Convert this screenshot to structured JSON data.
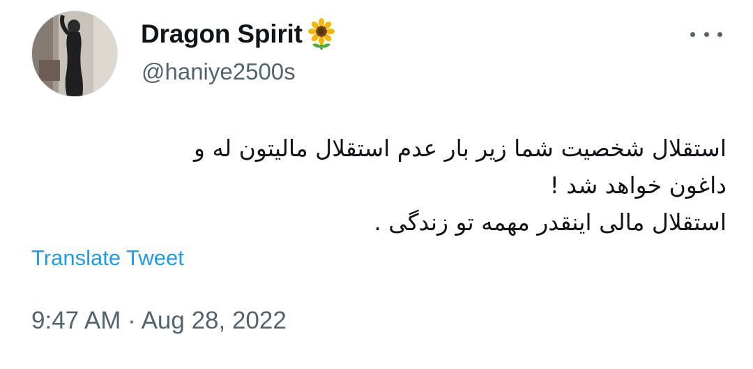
{
  "user": {
    "display_name": "Dragon Spirit",
    "badge_icon": "sunflower-emoji",
    "handle": "@haniye2500s"
  },
  "menu": {
    "icon": "more-options-icon"
  },
  "tweet": {
    "lines": [
      "استقلال شخصیت شما  زیر بار عدم استقلال مالیتون له و",
      "داغون خواهد شد !",
      "استقلال مالی اینقدر مهمه تو زندگی ."
    ],
    "translate_label": "Translate Tweet",
    "timestamp": "9:47 AM · Aug 28, 2022"
  },
  "colors": {
    "text_primary": "#0f1419",
    "text_secondary": "#536471",
    "link": "#1d9bf0"
  }
}
